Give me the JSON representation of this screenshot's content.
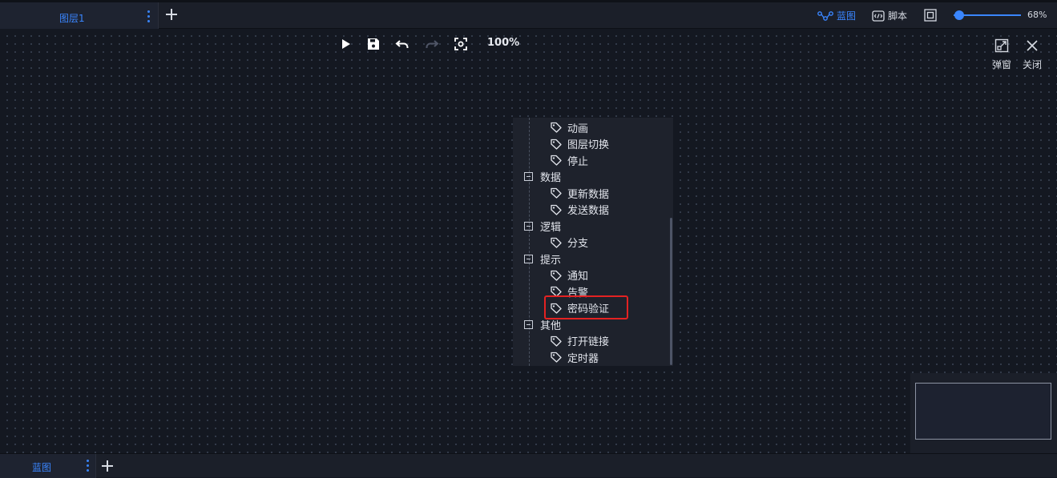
{
  "top_tabs": [
    {
      "label": "图层1"
    }
  ],
  "top_right": {
    "blueprint_label": "蓝图",
    "script_label": "脚本",
    "zoom_level": "68%",
    "zoom_fraction": 0.08
  },
  "canvas_toolbar": {
    "zoom_percent": "100%"
  },
  "corner_actions": {
    "popup_label": "弹窗",
    "close_label": "关闭"
  },
  "tree": {
    "nodes": [
      {
        "label": "动画",
        "kind": "leaf"
      },
      {
        "label": "图层切换",
        "kind": "leaf"
      },
      {
        "label": "停止",
        "kind": "leaf"
      },
      {
        "label": "数据",
        "kind": "group"
      },
      {
        "label": "更新数据",
        "kind": "leaf"
      },
      {
        "label": "发送数据",
        "kind": "leaf"
      },
      {
        "label": "逻辑",
        "kind": "group"
      },
      {
        "label": "分支",
        "kind": "leaf"
      },
      {
        "label": "提示",
        "kind": "group"
      },
      {
        "label": "通知",
        "kind": "leaf"
      },
      {
        "label": "告警",
        "kind": "leaf"
      },
      {
        "label": "密码验证",
        "kind": "leaf"
      },
      {
        "label": "其他",
        "kind": "group"
      },
      {
        "label": "打开链接",
        "kind": "leaf"
      },
      {
        "label": "定时器",
        "kind": "leaf"
      }
    ]
  },
  "bottom_tabs": [
    {
      "label": "蓝图"
    }
  ],
  "colors": {
    "accent": "#3a86ff",
    "highlight_border": "#e42222",
    "background": "#141821"
  }
}
